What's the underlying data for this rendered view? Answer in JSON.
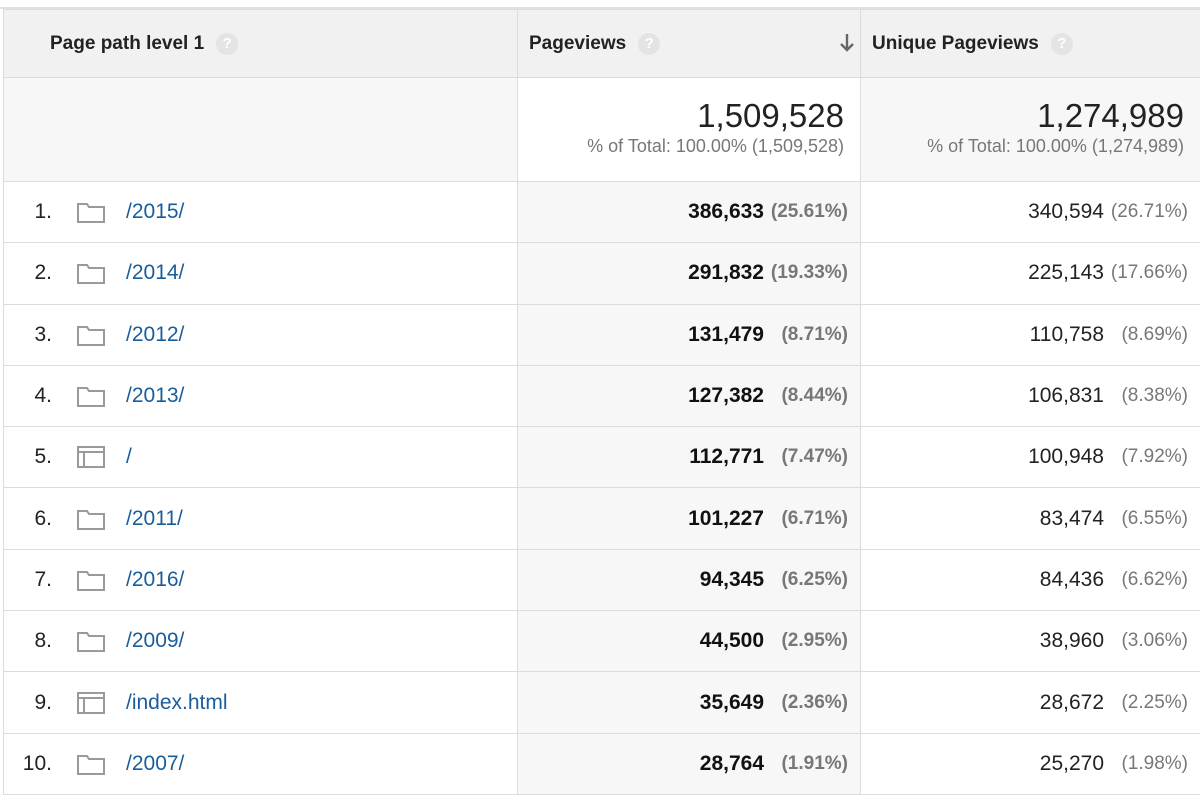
{
  "headers": {
    "dimension": "Page path level 1",
    "pageviews": "Pageviews",
    "unique_pageviews": "Unique Pageviews",
    "help_glyph": "?"
  },
  "totals": {
    "pageviews": {
      "value": "1,509,528",
      "sub": "% of Total: 100.00% (1,509,528)"
    },
    "unique_pageviews": {
      "value": "1,274,989",
      "sub": "% of Total: 100.00% (1,274,989)"
    }
  },
  "sort": {
    "column": "Pageviews",
    "direction": "descending",
    "icon": "arrow-down-icon"
  },
  "colors": {
    "link": "#1a5d9c",
    "header_bg": "#f1f1f1",
    "muted_text": "#777777"
  },
  "rows": [
    {
      "index": "1.",
      "icon": "folder-icon",
      "path": "/2015/",
      "pageviews": "386,633",
      "pageviews_pct": "(25.61%)",
      "unique_pageviews": "340,594",
      "unique_pageviews_pct": "(26.71%)"
    },
    {
      "index": "2.",
      "icon": "folder-icon",
      "path": "/2014/",
      "pageviews": "291,832",
      "pageviews_pct": "(19.33%)",
      "unique_pageviews": "225,143",
      "unique_pageviews_pct": "(17.66%)"
    },
    {
      "index": "3.",
      "icon": "folder-icon",
      "path": "/2012/",
      "pageviews": "131,479",
      "pageviews_pct": "(8.71%)",
      "unique_pageviews": "110,758",
      "unique_pageviews_pct": "(8.69%)"
    },
    {
      "index": "4.",
      "icon": "folder-icon",
      "path": "/2013/",
      "pageviews": "127,382",
      "pageviews_pct": "(8.44%)",
      "unique_pageviews": "106,831",
      "unique_pageviews_pct": "(8.38%)"
    },
    {
      "index": "5.",
      "icon": "page-icon",
      "path": "/",
      "pageviews": "112,771",
      "pageviews_pct": "(7.47%)",
      "unique_pageviews": "100,948",
      "unique_pageviews_pct": "(7.92%)"
    },
    {
      "index": "6.",
      "icon": "folder-icon",
      "path": "/2011/",
      "pageviews": "101,227",
      "pageviews_pct": "(6.71%)",
      "unique_pageviews": "83,474",
      "unique_pageviews_pct": "(6.55%)"
    },
    {
      "index": "7.",
      "icon": "folder-icon",
      "path": "/2016/",
      "pageviews": "94,345",
      "pageviews_pct": "(6.25%)",
      "unique_pageviews": "84,436",
      "unique_pageviews_pct": "(6.62%)"
    },
    {
      "index": "8.",
      "icon": "folder-icon",
      "path": "/2009/",
      "pageviews": "44,500",
      "pageviews_pct": "(2.95%)",
      "unique_pageviews": "38,960",
      "unique_pageviews_pct": "(3.06%)"
    },
    {
      "index": "9.",
      "icon": "page-icon",
      "path": "/index.html",
      "pageviews": "35,649",
      "pageviews_pct": "(2.36%)",
      "unique_pageviews": "28,672",
      "unique_pageviews_pct": "(2.25%)"
    },
    {
      "index": "10.",
      "icon": "folder-icon",
      "path": "/2007/",
      "pageviews": "28,764",
      "pageviews_pct": "(1.91%)",
      "unique_pageviews": "25,270",
      "unique_pageviews_pct": "(1.98%)"
    }
  ]
}
